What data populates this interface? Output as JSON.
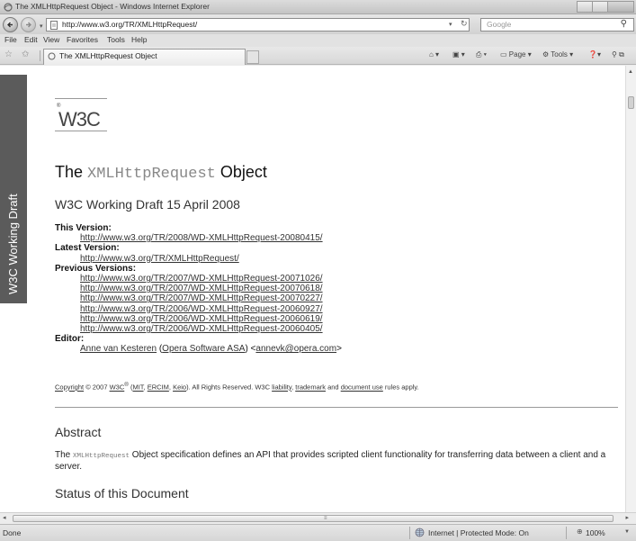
{
  "window": {
    "title": "The XMLHttpRequest Object - Windows Internet Explorer"
  },
  "address_bar": {
    "url": "http://www.w3.org/TR/XMLHttpRequest/",
    "search_placeholder": "Google"
  },
  "menu": [
    "File",
    "Edit",
    "View",
    "Favorites",
    "Tools",
    "Help"
  ],
  "tabs": [
    {
      "label": "The XMLHttpRequest Object"
    }
  ],
  "command_bar": {
    "page_label": "Page",
    "tools_label": "Tools"
  },
  "sidebar_badge": "W3C Working Draft",
  "document": {
    "logo_text": "W3C",
    "title_prefix": "The ",
    "title_code": "XMLHttpRequest",
    "title_suffix": " Object",
    "subtitle": "W3C Working Draft 15 April 2008",
    "this_version_label": "This Version:",
    "this_version_url": "http://www.w3.org/TR/2008/WD-XMLHttpRequest-20080415/",
    "latest_version_label": "Latest Version:",
    "latest_version_url": "http://www.w3.org/TR/XMLHttpRequest/",
    "previous_versions_label": "Previous Versions:",
    "previous_versions": [
      "http://www.w3.org/TR/2007/WD-XMLHttpRequest-20071026/",
      "http://www.w3.org/TR/2007/WD-XMLHttpRequest-20070618/",
      "http://www.w3.org/TR/2007/WD-XMLHttpRequest-20070227/",
      "http://www.w3.org/TR/2006/WD-XMLHttpRequest-20060927/",
      "http://www.w3.org/TR/2006/WD-XMLHttpRequest-20060619/",
      "http://www.w3.org/TR/2006/WD-XMLHttpRequest-20060405/"
    ],
    "editor_label": "Editor:",
    "editor_name": "Anne van Kesteren",
    "editor_org": "Opera Software ASA",
    "editor_email": "annevk@opera.com",
    "copyright": {
      "copyright_link": "Copyright",
      "year_text": " © 2007 ",
      "w3c_link": "W3C",
      "reg": "®",
      "mit": "MIT",
      "ercim": "ERCIM",
      "keio": "Keio",
      "rights_text": "). All Rights Reserved. W3C ",
      "liability": "liability",
      "trademark": "trademark",
      "doc_use": "document use",
      "tail": " rules apply."
    },
    "abstract_heading": "Abstract",
    "abstract_prefix": "The ",
    "abstract_code": "XMLHttpRequest",
    "abstract_text": " Object specification defines an API that provides scripted client functionality for transferring data between a client and a server.",
    "status_heading": "Status of this Document"
  },
  "status_bar": {
    "left": "Done",
    "zone": "Internet | Protected Mode: On",
    "zoom": "100%"
  }
}
